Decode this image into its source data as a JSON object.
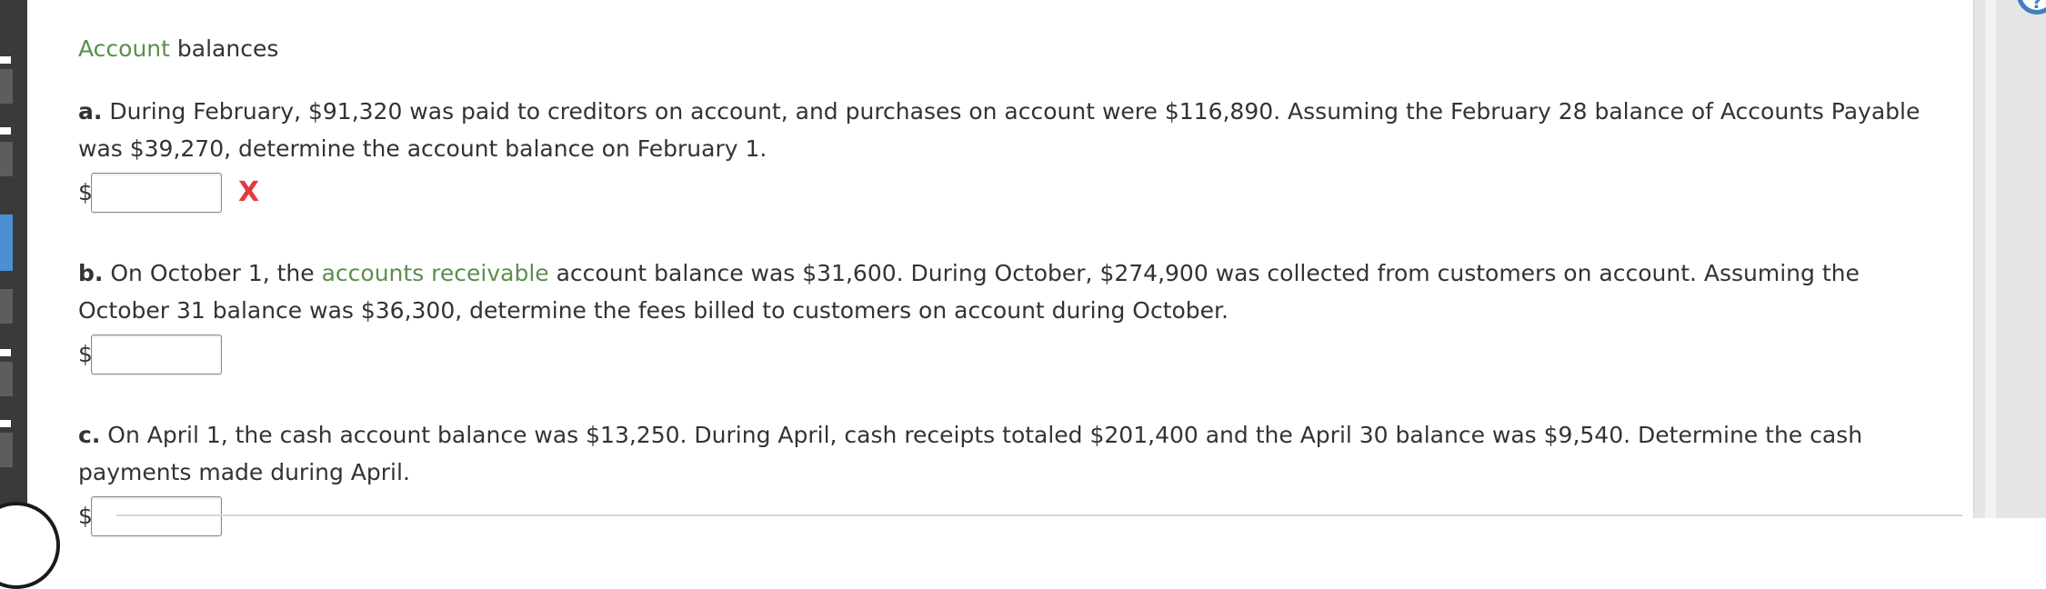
{
  "title": {
    "link_text": "Account",
    "rest": " balances"
  },
  "questions": [
    {
      "letter": "a.",
      "text_1": " During February, $91,320 was paid to creditors on account, and purchases on account were $116,890. Assuming the February 28 balance of Accounts Payable was $39,270, determine the account balance on February 1.",
      "link_text": "",
      "text_2": "",
      "currency": "$",
      "answer_value": "",
      "feedback": "X"
    },
    {
      "letter": "b.",
      "text_1": " On October 1, the ",
      "link_text": "accounts receivable",
      "text_2": " account balance was $31,600. During October, $274,900 was collected from customers on account. Assuming the October 31 balance was $36,300, determine the fees billed to customers on account during October.",
      "currency": "$",
      "answer_value": "",
      "feedback": ""
    },
    {
      "letter": "c.",
      "text_1": " On April 1, the cash account balance was $13,250. During April, cash receipts totaled $201,400 and the April 30 balance was $9,540. Determine the cash payments made during April.",
      "link_text": "",
      "text_2": "",
      "currency": "$",
      "answer_value": "",
      "feedback": ""
    }
  ],
  "colors": {
    "link_green": "#5b8f4c",
    "incorrect_red": "#e33b3b",
    "text": "#333333",
    "active_nav_blue": "#4a90d2"
  },
  "icons": {
    "feedback": "incorrect-x-icon",
    "help": "help-circle-icon"
  }
}
